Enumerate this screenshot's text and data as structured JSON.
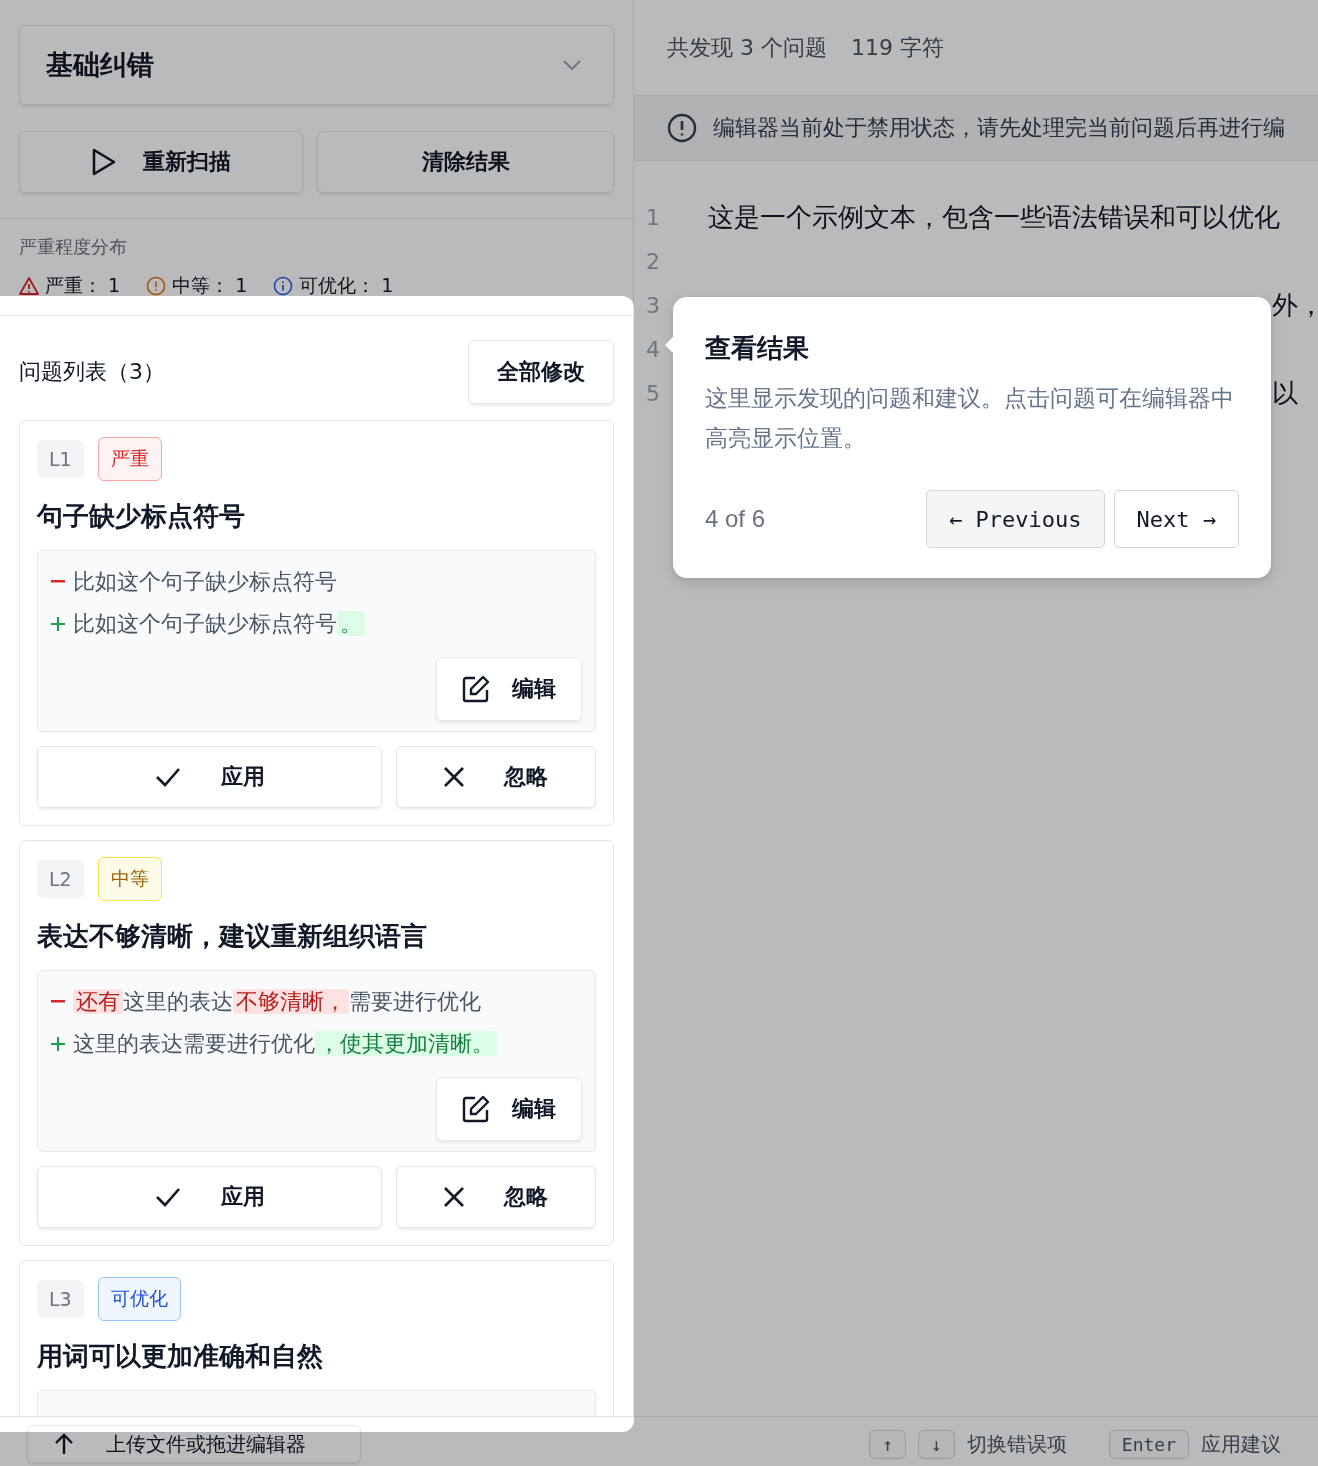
{
  "mode_select": {
    "value": "基础纠错"
  },
  "actions": [
    {
      "kind": "rescan",
      "label": "重新扫描"
    },
    {
      "kind": "clear",
      "label": "清除结果"
    }
  ],
  "severity_summary": {
    "title": "严重程度分布",
    "items": [
      {
        "kind": "severe",
        "label": "严重：",
        "count": "1"
      },
      {
        "kind": "moderate",
        "label": "中等：",
        "count": "1"
      },
      {
        "kind": "minor",
        "label": "可优化：",
        "count": "1"
      }
    ]
  },
  "issue_list": {
    "title": "问题列表（3）",
    "fix_all": "全部修改",
    "issues": [
      {
        "line": "L1",
        "severity": "严重",
        "kind": "severe",
        "title": "句子缺少标点符号",
        "removed": [
          {
            "text": "比如这个句子缺少标点符号",
            "changed": false
          }
        ],
        "added": [
          {
            "text": "比如这个句子缺少标点符号",
            "changed": false
          },
          {
            "text": "。",
            "changed": true
          }
        ],
        "edit": "编辑",
        "apply": "应用",
        "ignore": "忽略"
      },
      {
        "line": "L2",
        "severity": "中等",
        "kind": "moderate",
        "title": "表达不够清晰，建议重新组织语言",
        "removed": [
          {
            "text": "还有",
            "changed": true
          },
          {
            "text": "这里的表达",
            "changed": false
          },
          {
            "text": "不够清晰，",
            "changed": true
          },
          {
            "text": "需要进行优化",
            "changed": false
          }
        ],
        "added": [
          {
            "text": "这里的表达需要进行优化",
            "changed": false
          },
          {
            "text": "，使其更加清晰。",
            "changed": true
          }
        ],
        "edit": "编辑",
        "apply": "应用",
        "ignore": "忽略"
      },
      {
        "line": "L3",
        "severity": "可优化",
        "kind": "minor",
        "title": "用词可以更加准确和自然"
      }
    ]
  },
  "editor": {
    "stats": [
      "共发现 3 个问题",
      "119 字符"
    ],
    "notice": "编辑器当前处于禁用状态，请先处理完当前问题后再进行编",
    "lines": [
      {
        "number": "1",
        "text": "这是一个示例文本，包含一些语法错误和可以优化"
      },
      {
        "number": "2"
      },
      {
        "number": "3",
        "tail": "外，"
      },
      {
        "number": "4"
      },
      {
        "number": "5",
        "tail": "以"
      }
    ]
  },
  "tour": {
    "title": "查看结果",
    "body": "这里显示发现的问题和建议。点击问题可在编辑器中高亮显示位置。",
    "progress": "4 of 6",
    "previous": "← Previous",
    "next": "Next →"
  },
  "footer": {
    "upload": "上传文件或拖进编辑器",
    "shortcuts": [
      {
        "keys": [
          "↑",
          "↓"
        ],
        "label": "切换错误项"
      },
      {
        "keys": [
          "Enter"
        ],
        "label": "应用建议"
      }
    ]
  }
}
